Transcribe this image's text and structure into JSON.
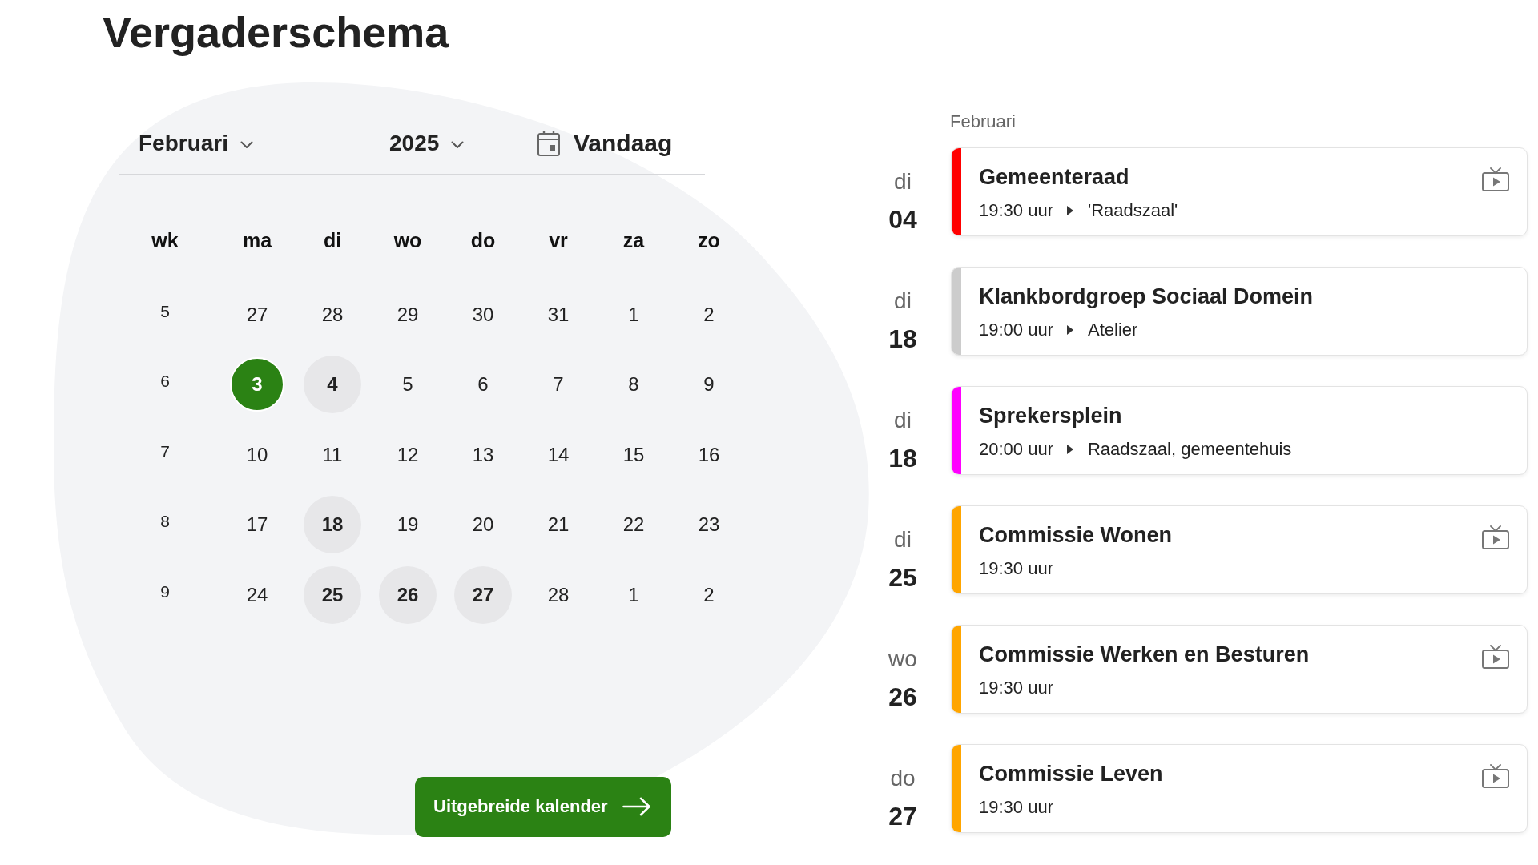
{
  "title": "Vergaderschema",
  "calendar": {
    "month": "Februari",
    "year": "2025",
    "today_button": "Vandaag",
    "week_header": "wk",
    "weekdays": [
      "ma",
      "di",
      "wo",
      "do",
      "vr",
      "za",
      "zo"
    ],
    "weeks": [
      {
        "week": "5",
        "days": [
          {
            "label": "27",
            "today": false,
            "has_meeting": false
          },
          {
            "label": "28",
            "today": false,
            "has_meeting": false
          },
          {
            "label": "29",
            "today": false,
            "has_meeting": false
          },
          {
            "label": "30",
            "today": false,
            "has_meeting": false
          },
          {
            "label": "31",
            "today": false,
            "has_meeting": false
          },
          {
            "label": "1",
            "today": false,
            "has_meeting": false
          },
          {
            "label": "2",
            "today": false,
            "has_meeting": false
          }
        ]
      },
      {
        "week": "6",
        "days": [
          {
            "label": "3",
            "today": true,
            "has_meeting": false
          },
          {
            "label": "4",
            "today": false,
            "has_meeting": true
          },
          {
            "label": "5",
            "today": false,
            "has_meeting": false
          },
          {
            "label": "6",
            "today": false,
            "has_meeting": false
          },
          {
            "label": "7",
            "today": false,
            "has_meeting": false
          },
          {
            "label": "8",
            "today": false,
            "has_meeting": false
          },
          {
            "label": "9",
            "today": false,
            "has_meeting": false
          }
        ]
      },
      {
        "week": "7",
        "days": [
          {
            "label": "10",
            "today": false,
            "has_meeting": false
          },
          {
            "label": "11",
            "today": false,
            "has_meeting": false
          },
          {
            "label": "12",
            "today": false,
            "has_meeting": false
          },
          {
            "label": "13",
            "today": false,
            "has_meeting": false
          },
          {
            "label": "14",
            "today": false,
            "has_meeting": false
          },
          {
            "label": "15",
            "today": false,
            "has_meeting": false
          },
          {
            "label": "16",
            "today": false,
            "has_meeting": false
          }
        ]
      },
      {
        "week": "8",
        "days": [
          {
            "label": "17",
            "today": false,
            "has_meeting": false
          },
          {
            "label": "18",
            "today": false,
            "has_meeting": true
          },
          {
            "label": "19",
            "today": false,
            "has_meeting": false
          },
          {
            "label": "20",
            "today": false,
            "has_meeting": false
          },
          {
            "label": "21",
            "today": false,
            "has_meeting": false
          },
          {
            "label": "22",
            "today": false,
            "has_meeting": false
          },
          {
            "label": "23",
            "today": false,
            "has_meeting": false
          }
        ]
      },
      {
        "week": "9",
        "days": [
          {
            "label": "24",
            "today": false,
            "has_meeting": false
          },
          {
            "label": "25",
            "today": false,
            "has_meeting": true
          },
          {
            "label": "26",
            "today": false,
            "has_meeting": true
          },
          {
            "label": "27",
            "today": false,
            "has_meeting": true
          },
          {
            "label": "28",
            "today": false,
            "has_meeting": false
          },
          {
            "label": "1",
            "today": false,
            "has_meeting": false
          },
          {
            "label": "2",
            "today": false,
            "has_meeting": false
          }
        ]
      }
    ],
    "more_button": "Uitgebreide kalender"
  },
  "agenda": {
    "month": "Februari",
    "events": [
      {
        "weekday": "di",
        "day": "04",
        "title": "Gemeenteraad",
        "time": "19:30 uur",
        "location": "'Raadszaal'",
        "color": "#ff0000",
        "video": true
      },
      {
        "weekday": "di",
        "day": "18",
        "title": "Klankbordgroep Sociaal Domein",
        "time": "19:00 uur",
        "location": "Atelier",
        "color": "#cccccc",
        "video": false
      },
      {
        "weekday": "di",
        "day": "18",
        "title": "Sprekersplein",
        "time": "20:00 uur",
        "location": "Raadszaal, gemeentehuis",
        "color": "#ff00ff",
        "video": false
      },
      {
        "weekday": "di",
        "day": "25",
        "title": "Commissie Wonen",
        "time": "19:30 uur",
        "color": "#ffa500",
        "video": true
      },
      {
        "weekday": "wo",
        "day": "26",
        "title": "Commissie Werken en Besturen",
        "time": "19:30 uur",
        "color": "#ffa500",
        "video": true
      },
      {
        "weekday": "do",
        "day": "27",
        "title": "Commissie Leven",
        "time": "19:30 uur",
        "color": "#ffa500",
        "video": true
      }
    ]
  }
}
